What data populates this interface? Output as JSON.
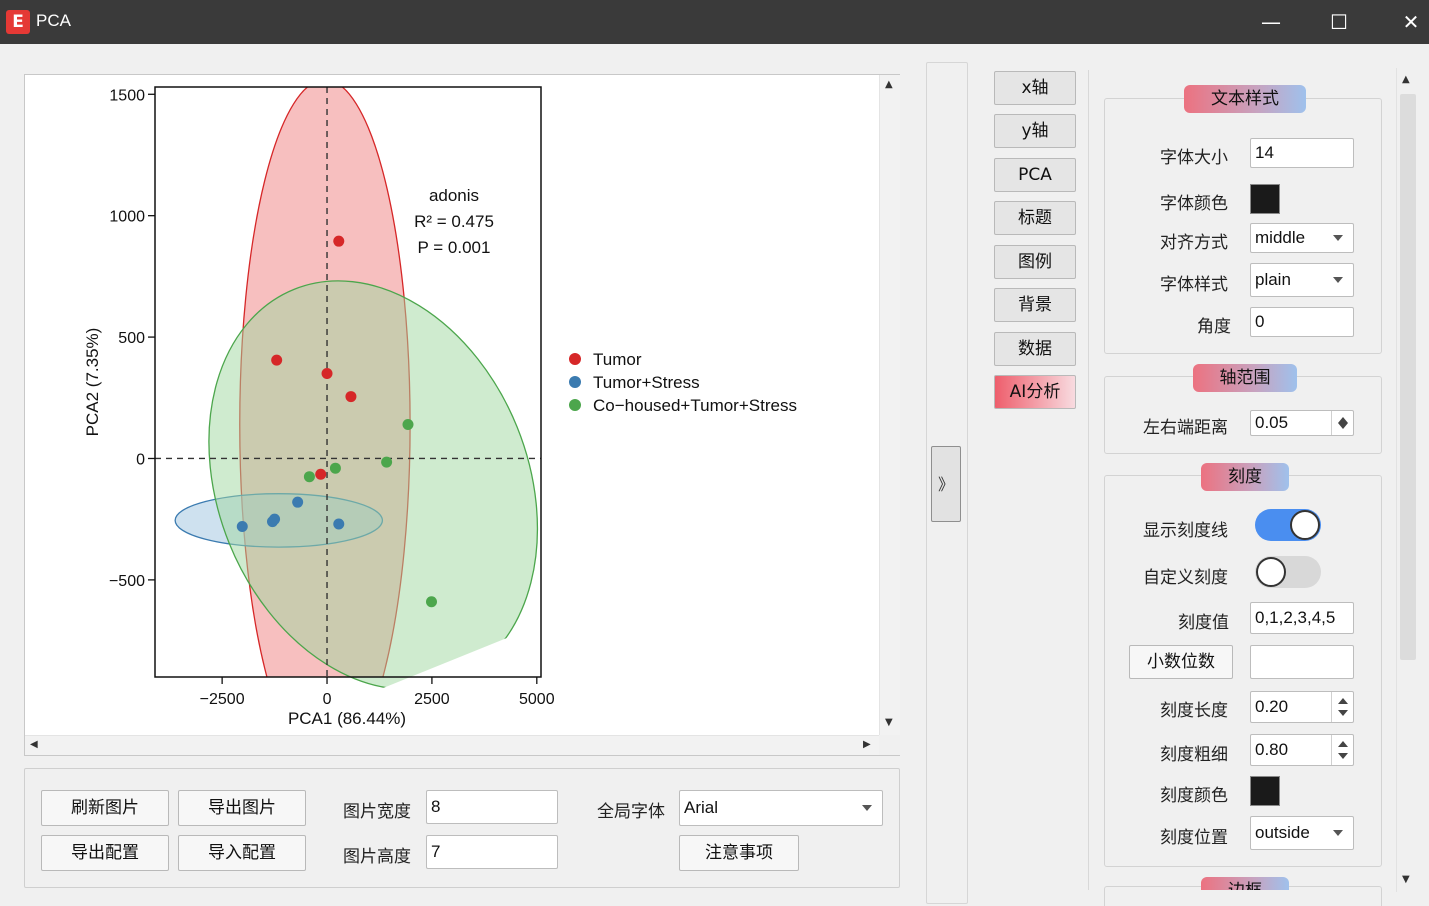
{
  "window": {
    "title": "PCA",
    "app_icon_letter": "E",
    "min_glyph": "—",
    "max_glyph": "☐",
    "close_glyph": "✕"
  },
  "chart_data": {
    "type": "scatter",
    "xlabel": "PCA1 (86.44%)",
    "ylabel": "PCA2 (7.35%)",
    "xlim": [
      -4100,
      5100
    ],
    "ylim": [
      -900,
      1530
    ],
    "xticks": [
      -2500,
      0,
      2500,
      5000
    ],
    "xtick_labels": [
      "−2500",
      "0",
      "2500",
      "5000"
    ],
    "yticks": [
      1500,
      1000,
      500,
      0,
      -500
    ],
    "ytick_labels": [
      "1500",
      "1000",
      "500",
      "0",
      "−500"
    ],
    "reference_lines": {
      "x": 0,
      "y": 0,
      "style": "dashed"
    },
    "annotation": [
      "adonis",
      "R² = 0.475",
      "P = 0.001"
    ],
    "legend_position": "right",
    "series": [
      {
        "name": "Tumor",
        "color": "#d62728",
        "fill": "#f08080",
        "points": [
          [
            280,
            895
          ],
          [
            -1200,
            405
          ],
          [
            0,
            350
          ],
          [
            570,
            255
          ],
          [
            -150,
            -65
          ]
        ],
        "ellipse": {
          "cx": -50,
          "cy": 140,
          "rx": 2030,
          "ry": 1420
        }
      },
      {
        "name": "Tumor+Stress",
        "color": "#3b7bb0",
        "fill": "#9dc3e0",
        "points": [
          [
            -2020,
            -280
          ],
          [
            -1300,
            -260
          ],
          [
            -1250,
            -250
          ],
          [
            -700,
            -180
          ],
          [
            280,
            -270
          ]
        ],
        "ellipse": {
          "cx": -1150,
          "cy": -255,
          "rx": 2470,
          "ry": 110
        }
      },
      {
        "name": "Co-housed+Tumor+Stress",
        "color": "#4ca64c",
        "fill": "#9fd89f",
        "points": [
          [
            1930,
            140
          ],
          [
            1420,
            -15
          ],
          [
            200,
            -40
          ],
          [
            -420,
            -75
          ],
          [
            2490,
            -590
          ]
        ],
        "ellipse": {
          "cx": 1100,
          "cy": -110,
          "rx": 3700,
          "ry": 870,
          "tilt_deg": -22
        }
      }
    ],
    "legend_labels": [
      "Tumor",
      "Tumor+Stress",
      "Co−housed+Tumor+Stress"
    ]
  },
  "bottom": {
    "refresh_label": "刷新图片",
    "export_image_label": "导出图片",
    "export_config_label": "导出配置",
    "import_config_label": "导入配置",
    "width_label": "图片宽度",
    "width_value": "8",
    "height_label": "图片高度",
    "height_value": "7",
    "font_label": "全局字体",
    "font_value": "Arial",
    "notes_label": "注意事项"
  },
  "splitter": {
    "glyph": "》"
  },
  "nav": {
    "items": [
      "x轴",
      "y轴",
      "PCA",
      "标题",
      "图例",
      "背景",
      "数据",
      "AI分析"
    ]
  },
  "text_style": {
    "title": "文本样式",
    "font_size_label": "字体大小",
    "font_size_value": "14",
    "font_color_label": "字体颜色",
    "font_color_value": "#1a1a1a",
    "align_label": "对齐方式",
    "align_value": "middle",
    "font_style_label": "字体样式",
    "font_style_value": "plain",
    "angle_label": "角度",
    "angle_value": "0"
  },
  "axis_range": {
    "title": "轴范围",
    "margin_label": "左右端距离",
    "margin_value": "0.05"
  },
  "ticks": {
    "title": "刻度",
    "show_label": "显示刻度线",
    "show_on": true,
    "custom_label": "自定义刻度",
    "custom_on": false,
    "values_label": "刻度值",
    "values_value": "0,1,2,3,4,5",
    "decimals_label": "小数位数",
    "decimals_value": "",
    "length_label": "刻度长度",
    "length_value": "0.20",
    "width_label": "刻度粗细",
    "width_value": "0.80",
    "color_label": "刻度颜色",
    "color_value": "#1a1a1a",
    "position_label": "刻度位置",
    "position_value": "outside"
  },
  "border": {
    "title": "边框"
  }
}
